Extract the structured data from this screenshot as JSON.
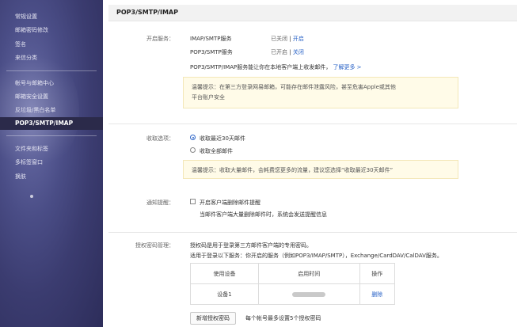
{
  "sidebar": {
    "items": [
      {
        "label": "常规设置"
      },
      {
        "label": "邮箱密码修改"
      },
      {
        "label": "签名"
      },
      {
        "label": "来信分类"
      },
      {
        "label": "帐号与邮箱中心"
      },
      {
        "label": "邮箱安全设置"
      },
      {
        "label": "反垃圾/黑白名单"
      },
      {
        "label": "POP3/SMTP/IMAP"
      },
      {
        "label": "文件夹和标签"
      },
      {
        "label": "多标签窗口"
      },
      {
        "label": "换肤"
      }
    ]
  },
  "header": {
    "title": "POP3/SMTP/IMAP"
  },
  "service": {
    "label": "开启服务：",
    "imap": {
      "name": "IMAP/SMTP服务",
      "status": "已关闭",
      "sep": "|",
      "action": "开启"
    },
    "pop3": {
      "name": "POP3/SMTP服务",
      "status": "已开启",
      "sep": "|",
      "action": "关闭"
    },
    "desc": "POP3/SMTP/IMAP服务能让你在本地客户端上收发邮件，",
    "learn_more": "了解更多 >",
    "tip_line1": "温馨提示：在第三方登录网易邮箱，可能存在邮件泄露风险，甚至危害Apple或其他",
    "tip_line2": "平台账户安全"
  },
  "receive": {
    "label": "收取选项：",
    "option1": "收取最近30天邮件",
    "option2": "收取全部邮件",
    "selected": "option1",
    "tip": "温馨提示：收取大量邮件，会耗费您更多的流量，建议您选择“收取最近30天邮件”"
  },
  "notify": {
    "label": "通知提醒：",
    "checkbox_label": "开启客户端删除邮件提醒",
    "desc": "当邮件客户端大量删除邮件时，系统会发送提醒信息"
  },
  "auth": {
    "label": "授权密码管理：",
    "desc1": "授权码是用于登录第三方邮件客户端的专用密码。",
    "desc2": "适用于登录以下服务：你开启的服务（例如POP3/IMAP/SMTP），Exchange/CardDAV/CalDAV服务。",
    "table": {
      "headers": [
        "使用设备",
        "启用时间",
        "操作"
      ],
      "rows": [
        {
          "device": "设备1",
          "action": "删除"
        }
      ]
    },
    "add_button": "新增授权密码",
    "limit_note": "每个帐号最多设置5个授权密码"
  }
}
